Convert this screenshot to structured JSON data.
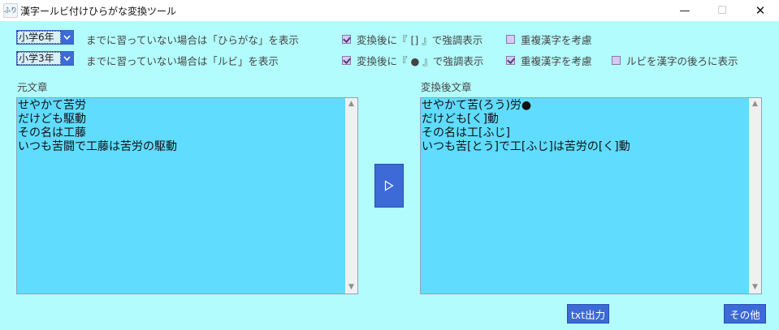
{
  "window": {
    "title": "漢字ールビ付けひらがな変換ツール",
    "icon_text": "ふり",
    "minimize_glyph": "—",
    "maximize_glyph": "☐",
    "close_glyph": "✕"
  },
  "settings": {
    "hiragana_row": {
      "grade": "小学6年",
      "text": "までに習っていない場合は「ひらがな」を表示",
      "options": [
        {
          "label": "変換後に『 [] 』で強調表示",
          "checked": true
        },
        {
          "label": "重複漢字を考慮",
          "checked": false
        }
      ]
    },
    "ruby_row": {
      "grade": "小学3年",
      "text": "までに習っていない場合は「ルビ」を表示",
      "options": [
        {
          "label": "変換後に『 ● 』で強調表示",
          "checked": true
        },
        {
          "label": "重複漢字を考慮",
          "checked": true
        },
        {
          "label": "ルビを漢字の後ろに表示",
          "checked": false
        }
      ]
    }
  },
  "source": {
    "label": "元文章",
    "text": "せやかて苦労\nだけども駆動\nその名は工藤\nいつも苦闘で工藤は苦労の駆動"
  },
  "result": {
    "label": "変換後文章",
    "text": "せやかて苦(ろう)労●\nだけども[く]動\nその名は工[ふじ]\nいつも苦[とう]で工[ふじ]は苦労の[く]動"
  },
  "buttons": {
    "convert_glyph": "▷",
    "txt_export": "txt出力",
    "other": "その他"
  },
  "colors": {
    "background": "#b3fcfd",
    "textarea": "#60dcfe",
    "accent": "#3c6ad6",
    "checkbox": "#d8c8f4"
  }
}
